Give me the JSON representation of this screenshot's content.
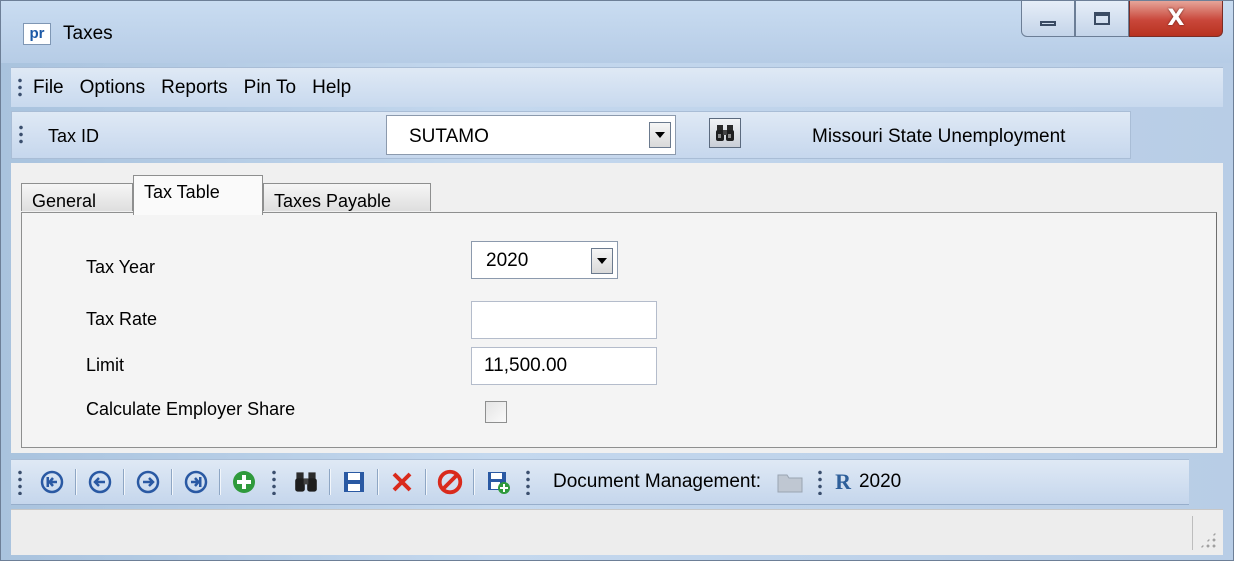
{
  "window": {
    "app_logo_text": "pr",
    "title": "Taxes",
    "close_symbol": "X"
  },
  "menu": {
    "items": [
      "File",
      "Options",
      "Reports",
      "Pin To",
      "Help"
    ]
  },
  "tax_id_bar": {
    "label": "Tax ID",
    "value": "SUTAMO",
    "description": "Missouri State Unemployment"
  },
  "tabs": [
    {
      "label": "General",
      "active": false
    },
    {
      "label": "Tax Table",
      "active": true
    },
    {
      "label": "Taxes Payable",
      "active": false
    }
  ],
  "tax_table": {
    "tax_year_label": "Tax Year",
    "tax_year_value": "2020",
    "tax_rate_label": "Tax Rate",
    "tax_rate_value": "",
    "limit_label": "Limit",
    "limit_value": "11,500.00",
    "employer_share_label": "Calculate Employer Share",
    "employer_share_checked": false
  },
  "toolbar": {
    "icons": [
      "first-record-icon",
      "previous-record-icon",
      "next-record-icon",
      "last-record-icon",
      "add-icon",
      "find-icon",
      "save-icon",
      "delete-icon",
      "cancel-icon",
      "save-new-icon",
      "folder-icon",
      "year-icon"
    ],
    "document_management_label": "Document Management:",
    "year_label": "2020"
  },
  "colors": {
    "title_bar": "#b6cce6",
    "toolbar": "#c8d9ee",
    "nav_icon": "#2a59a3",
    "add_icon": "#2f9a3c",
    "delete_icon": "#d92a1c",
    "cancel_icon": "#d92a1c",
    "save_icon": "#2a59a3"
  }
}
